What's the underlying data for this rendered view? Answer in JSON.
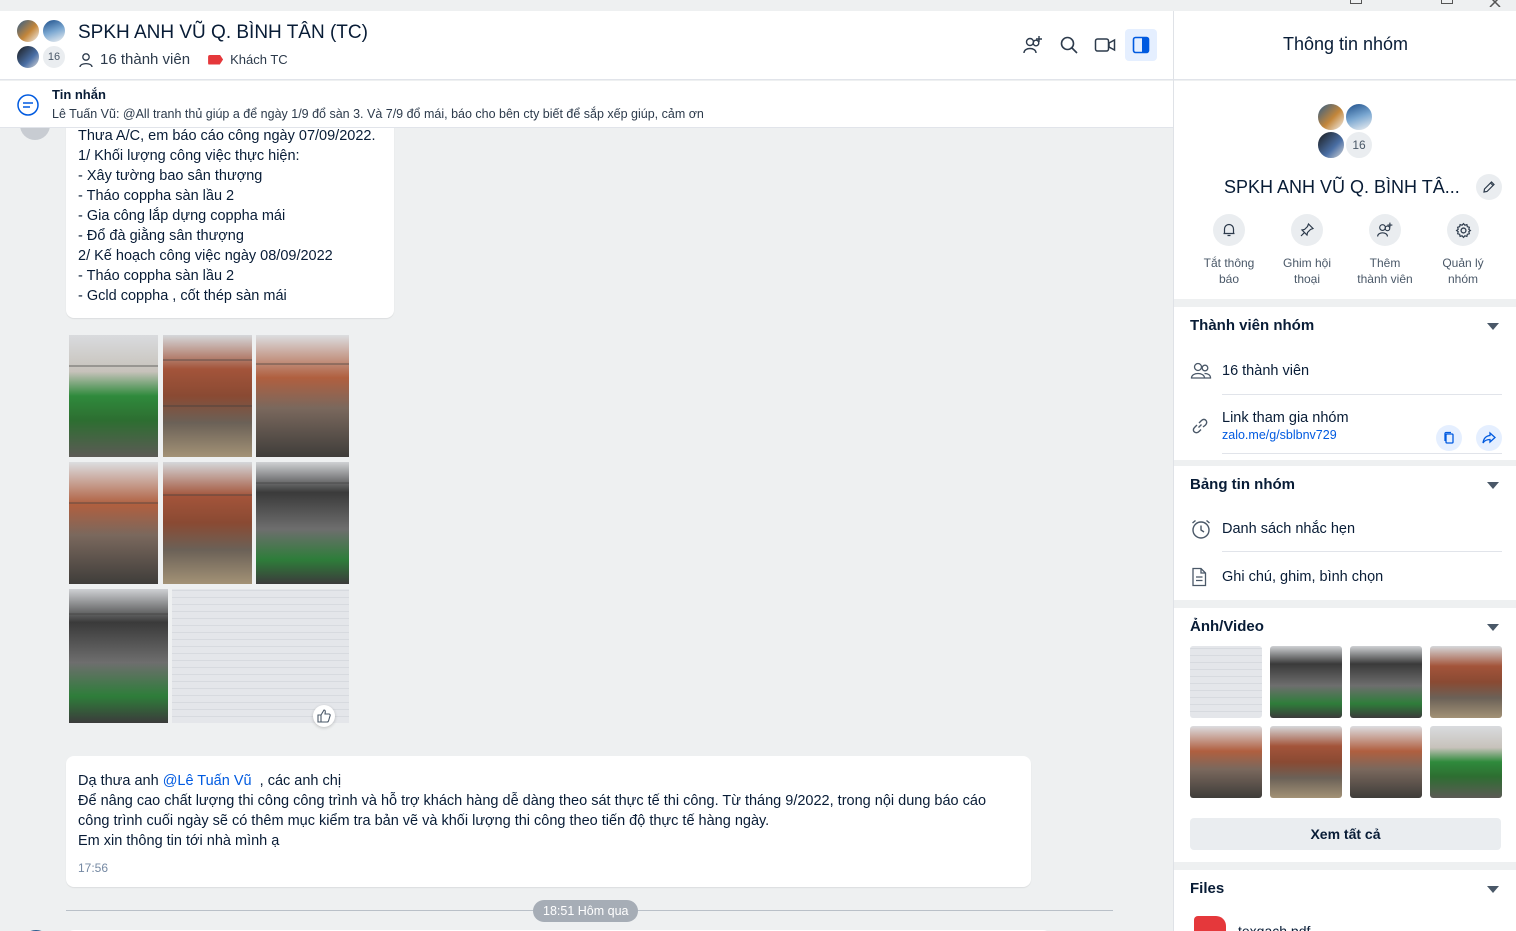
{
  "chat": {
    "title": "SPKH ANH VŨ Q. BÌNH TÂN (TC)",
    "member_count_badge": "16",
    "members_label": "16 thành viên",
    "tag_label": "Khách TC"
  },
  "pinned": {
    "title": "Tin nhắn",
    "text": "Lê Tuấn Vũ: @All  tranh thủ giúp a để ngày 1/9 đổ sàn 3. Và 7/9 đổ mái, báo cho bên cty biết để sắp xếp giúp, cảm ơn"
  },
  "messages": {
    "report_lines": [
      "Thưa A/C, em báo cáo công ngày 07/09/2022.",
      "1/ Khối lượng công việc thực hiện:",
      "- Xây tường bao sân thượng",
      "- Tháo coppha sàn lầu 2",
      "- Gia công lắp dựng coppha mái",
      "- Đổ đà giằng sân thượng",
      "2/ Kế hoạch công việc ngày 08/09/2022",
      "- Tháo coppha sàn lầu 2",
      "- Gcld coppha , cốt thép sàn mái"
    ],
    "reply": {
      "prefix": "Dạ thưa anh ",
      "mention": "@Lê Tuấn Vũ",
      "suffix": "  , các anh chị",
      "line2": "Để nâng cao chất lượng thi công công trình và hỗ trợ khách hàng dễ dàng theo sát thực tế thi công. Từ tháng 9/2022, trong nội dung báo cáo",
      "line3": "công trình cuối ngày sẽ có thêm mục kiểm tra bản vẽ và khối lượng thi công theo tiến độ thực tế hàng ngày.",
      "line4": "Em xin thông tin tới nhà mình ạ",
      "time": "17:56"
    },
    "time_divider": "18:51 Hôm qua"
  },
  "panel": {
    "title": "Thông tin nhóm",
    "member_badge": "16",
    "group_name": "SPKH ANH VŨ Q. BÌNH TÂ...",
    "actions": [
      {
        "line1": "Tắt thông",
        "line2": "báo",
        "icon": "bell-icon"
      },
      {
        "line1": "Ghim hội",
        "line2": "thoại",
        "icon": "pin-icon"
      },
      {
        "line1": "Thêm",
        "line2": "thành viên",
        "icon": "add-member-icon"
      },
      {
        "line1": "Quản lý",
        "line2": "nhóm",
        "icon": "gear-icon"
      }
    ],
    "members_section": {
      "title": "Thành viên nhóm",
      "members": "16 thành viên",
      "link_label": "Link tham gia nhóm",
      "link_url": "zalo.me/g/sblbnv729"
    },
    "board_section": {
      "title": "Bảng tin nhóm",
      "reminders": "Danh sách nhắc hẹn",
      "notes": "Ghi chú, ghim, bình chọn"
    },
    "media_section": {
      "title": "Ảnh/Video",
      "see_all": "Xem tất cả"
    },
    "files_section": {
      "title": "Files",
      "file_name": "texgach.pdf"
    }
  },
  "colors": {
    "accent": "#005ae0",
    "background": "#eef0f1",
    "tag_red": "#e5383b"
  }
}
